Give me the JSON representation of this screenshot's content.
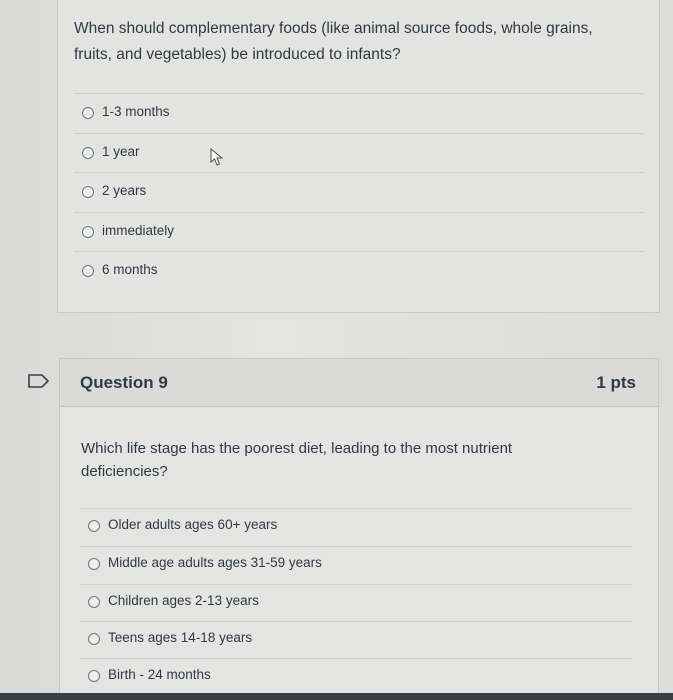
{
  "question8": {
    "text": "When should complementary foods (like animal source foods, whole grains, fruits, and vegetables) be introduced to infants?",
    "choices": [
      "1-3 months",
      "1 year",
      "2 years",
      "immediately",
      "6 months"
    ]
  },
  "question9": {
    "title": "Question 9",
    "points": "1 pts",
    "text": "Which life stage has the poorest diet, leading to the most nutrient deficiencies?",
    "choices": [
      "Older adults ages 60+ years",
      "Middle age adults ages 31-59 years",
      "Children ages 2-13 years",
      "Teens ages 14-18 years",
      "Birth - 24 months"
    ]
  },
  "icons": {
    "flag": "flag-icon",
    "cursor": "mouse-cursor-icon"
  }
}
